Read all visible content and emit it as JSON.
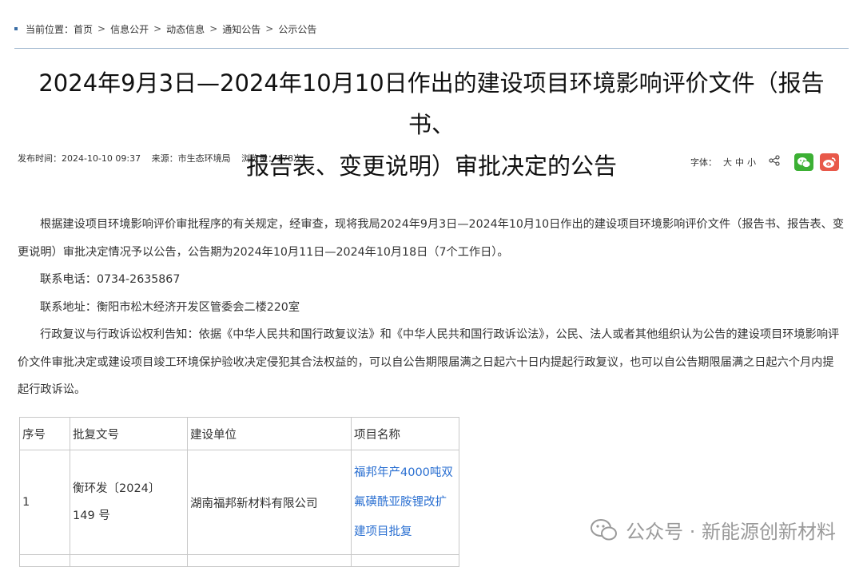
{
  "breadcrumb": {
    "label": "当前位置：",
    "items": [
      "首页",
      "信息公开",
      "动态信息",
      "通知公告",
      "公示公告"
    ],
    "separator": ">"
  },
  "title": {
    "line1": "2024年9月3日—2024年10月10日作出的建设项目环境影响评价文件（报告书、",
    "line2": "报告表、变更说明）审批决定的公告"
  },
  "meta": {
    "publish": "发布时间：2024-10-10 09:37",
    "source": "来源：市生态环境局",
    "views": "浏览量：178次"
  },
  "tools": {
    "font_label": "字体：",
    "sizes": [
      "大",
      "中",
      "小"
    ],
    "share_icon": "share-icon",
    "wechat_icon": "wechat-icon",
    "weibo_icon": "weibo-icon",
    "colors": {
      "wechat": "#3cb034",
      "weibo": "#e8594a"
    }
  },
  "body": {
    "p1": "根据建设项目环境影响评价审批程序的有关规定，经审查，现将我局2024年9月3日—2024年10月10日作出的建设项目环境影响评价文件（报告书、报告表、变更说明）审批决定情况予以公告，公告期为2024年10月11日—2024年10月18日（7个工作日）。",
    "p2": "联系电话：0734-2635867",
    "p3": "联系地址：衡阳市松木经济开发区管委会二楼220室",
    "p4": "行政复议与行政诉讼权利告知：依据《中华人民共和国行政复议法》和《中华人民共和国行政诉讼法》，公民、法人或者其他组织认为公告的建设项目环境影响评价文件审批决定或建设项目竣工环境保护验收决定侵犯其合法权益的，可以自公告期限届满之日起六十日内提起行政复议，也可以自公告期限届满之日起六个月内提起行政诉讼。"
  },
  "table": {
    "headers": [
      "序号",
      "批复文号",
      "建设单位",
      "项目名称"
    ],
    "rows": [
      {
        "no": "1",
        "doc_line1": "衡环发〔2024〕",
        "doc_line2": "149 号",
        "unit": "湖南福邦新材料有限公司",
        "project_line1": "福邦年产4000吨双",
        "project_line2": "氟磺酰亚胺锂改扩",
        "project_line3": "建项目批复"
      }
    ],
    "link_color": "#2a6fd1"
  },
  "watermark": {
    "text": "公众号 · 新能源创新材料",
    "icon": "wechat-bubble-icon"
  }
}
